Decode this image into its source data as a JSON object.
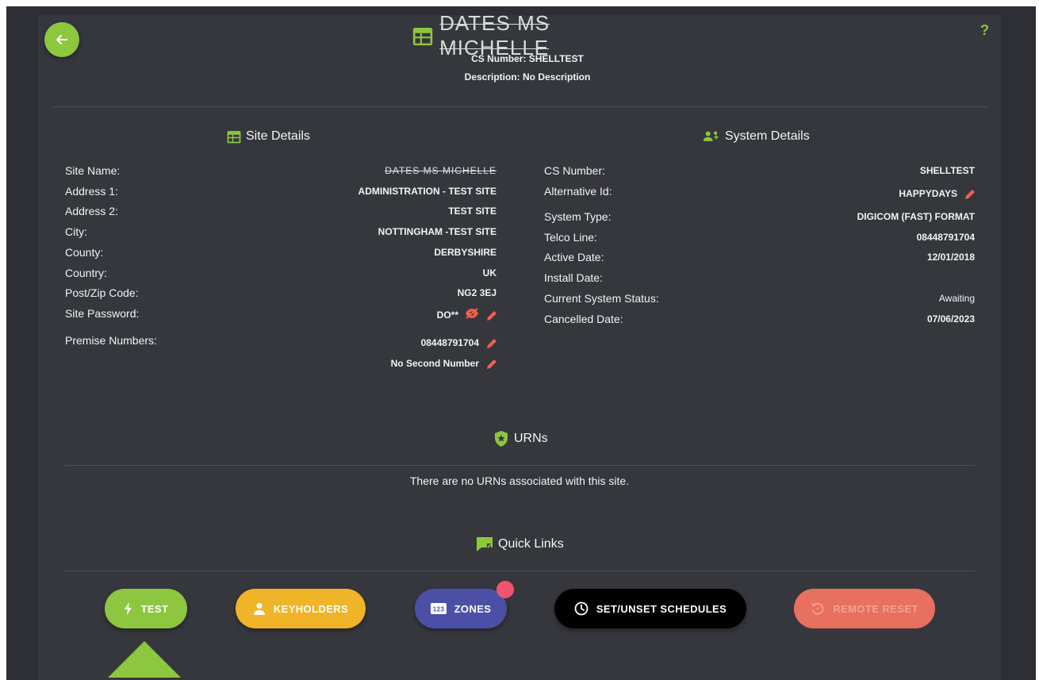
{
  "header": {
    "title": "DATES MS MICHELLE",
    "cs_number": "CS Number: SHELLTEST",
    "description": "Description: No Description",
    "help": "?"
  },
  "site_details": {
    "heading": "Site Details",
    "rows": [
      {
        "label": "Site Name:",
        "value": "DATES MS MICHELLE"
      },
      {
        "label": "Address 1:",
        "value": "ADMINISTRATION - TEST SITE"
      },
      {
        "label": "Address 2:",
        "value": "TEST SITE"
      },
      {
        "label": "City:",
        "value": "NOTTINGHAM -TEST SITE"
      },
      {
        "label": "County:",
        "value": "DERBYSHIRE"
      },
      {
        "label": "Country:",
        "value": "UK"
      },
      {
        "label": "Post/Zip Code:",
        "value": "NG2 3EJ"
      },
      {
        "label": "Site Password:",
        "value": "DO**"
      },
      {
        "label": "Premise Numbers:",
        "value": "08448791704"
      }
    ],
    "second_number": "No Second Number"
  },
  "system_details": {
    "heading": "System Details",
    "rows": [
      {
        "label": "CS Number:",
        "value": "SHELLTEST"
      },
      {
        "label": "Alternative Id:",
        "value": "HAPPYDAYS"
      },
      {
        "label": "System Type:",
        "value": "DIGICOM (FAST) FORMAT"
      },
      {
        "label": "Telco Line:",
        "value": "08448791704"
      },
      {
        "label": "Active Date:",
        "value": "12/01/2018"
      },
      {
        "label": "Install Date:",
        "value": ""
      },
      {
        "label": "Current System Status:",
        "value": "Awaiting"
      },
      {
        "label": "Cancelled Date:",
        "value": "07/06/2023"
      }
    ]
  },
  "urns": {
    "heading": "URNs",
    "empty_text": "There are no URNs associated with this site."
  },
  "quick_links": {
    "heading": "Quick Links",
    "buttons": [
      {
        "label": "TEST",
        "icon": "lightning-icon",
        "color": "#8dc63f"
      },
      {
        "label": "KEYHOLDERS",
        "icon": "person-icon",
        "color": "#f0b429"
      },
      {
        "label": "ZONES",
        "icon": "numbers-icon",
        "color": "#4b4fa6"
      },
      {
        "label": "SET/UNSET SCHEDULES",
        "icon": "clock-icon",
        "color": "#000000"
      },
      {
        "label": "REMOTE RESET",
        "icon": "reset-icon",
        "color": "#e8705f"
      }
    ]
  },
  "colors": {
    "accent": "#8dc63f",
    "edit": "#f0604d",
    "background": "#36373d"
  }
}
